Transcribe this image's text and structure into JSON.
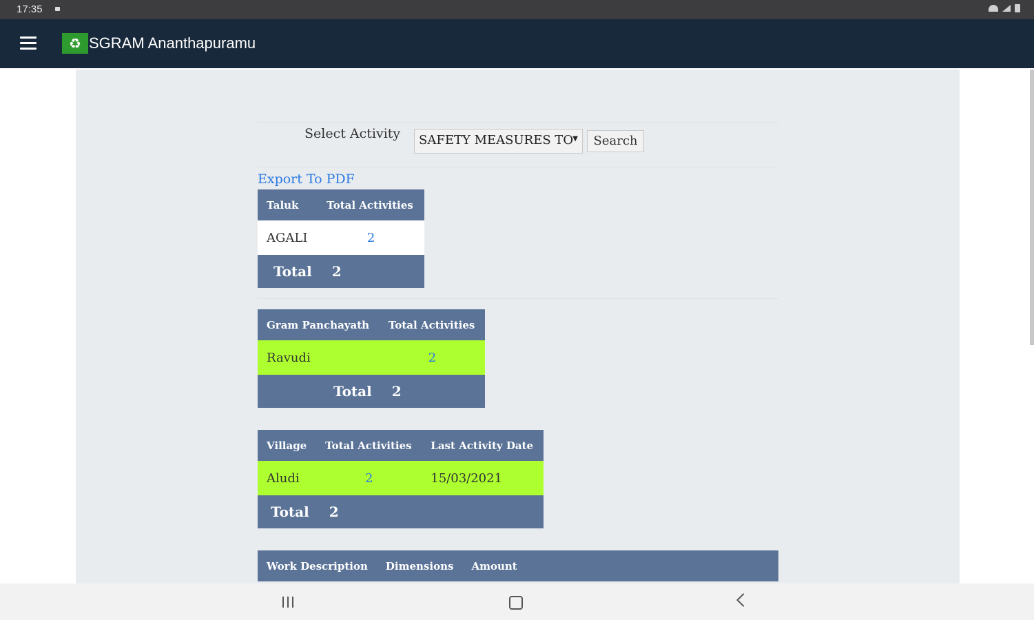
{
  "status_bar": {
    "time": "17:35"
  },
  "app_bar": {
    "logo_glyph": "♻",
    "title": "SGRAM Ananthapuramu"
  },
  "filter": {
    "label": "Select Activity",
    "selected_activity": "SAFETY MEASURES TO",
    "dropdown_arrow": "▼",
    "search_label": "Search"
  },
  "export_label": "Export To PDF",
  "taluk_table": {
    "headers": [
      "Taluk",
      "Total Activities"
    ],
    "rows": [
      {
        "name": "AGALI",
        "total": "2"
      }
    ],
    "total_label": "Total",
    "total_value": "2"
  },
  "panchayath_table": {
    "headers": [
      "Gram Panchayath",
      "Total Activities"
    ],
    "rows": [
      {
        "name": "Ravudi",
        "total": "2"
      }
    ],
    "total_label": "Total",
    "total_value": "2"
  },
  "village_table": {
    "headers": [
      "Village",
      "Total Activities",
      "Last Activity Date"
    ],
    "rows": [
      {
        "name": "Aludi",
        "total": "2",
        "last_date": "15/03/2021"
      }
    ],
    "total_label": "Total",
    "total_value": "2"
  },
  "work_table": {
    "headers": [
      "Work Description",
      "Dimensions",
      "Amount"
    ]
  },
  "colors": {
    "app_bar": "#17293a",
    "table_header": "#5a7397",
    "highlight_row": "#adff2f",
    "link": "#2a7ae2",
    "content_bg": "#e9ecef"
  }
}
